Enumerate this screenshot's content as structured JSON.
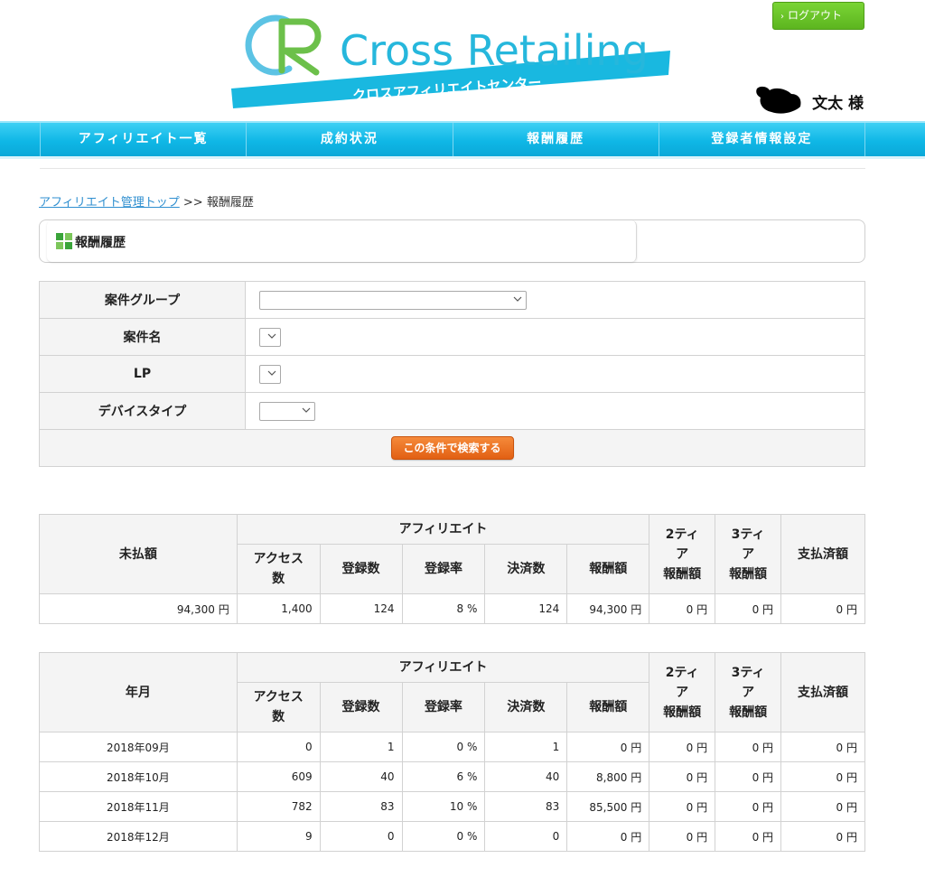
{
  "header": {
    "logo_text": "Cross Retailing",
    "logo_subtext": "クロスアフィリエイトセンター",
    "logout_label": "ログアウト",
    "user_name": "文太 様",
    "colors": {
      "brand_cyan": "#19b8e0",
      "logo_green": "#6cc04a",
      "logout_green": "#6cc52a",
      "search_orange": "#eb7325"
    }
  },
  "nav": {
    "items": [
      "アフィリエイト一覧",
      "成約状況",
      "報酬履歴",
      "登録者情報設定"
    ]
  },
  "breadcrumb": {
    "link": "アフィリエイト管理トップ",
    "separator": ">>",
    "current": "報酬履歴"
  },
  "section": {
    "title": "報酬履歴",
    "icon": "grid-icon"
  },
  "search_form": {
    "rows": [
      {
        "label": "案件グループ",
        "value": ""
      },
      {
        "label": "案件名",
        "value": ""
      },
      {
        "label": "LP",
        "value": ""
      },
      {
        "label": "デバイスタイプ",
        "value": ""
      }
    ],
    "search_button": "この条件で検索する"
  },
  "summary_table": {
    "first_header": "未払額",
    "group_header": "アフィリエイト",
    "sub_headers": [
      "アクセス数",
      "登録数",
      "登録率",
      "決済数",
      "報酬額"
    ],
    "tier2_header": "2ティア報酬額",
    "tier3_header": "3ティア報酬額",
    "paid_header": "支払済額",
    "row": [
      "94,300 円",
      "1,400",
      "124",
      "8 %",
      "124",
      "94,300 円",
      "0 円",
      "0 円",
      "0 円"
    ]
  },
  "monthly_table": {
    "first_header": "年月",
    "group_header": "アフィリエイト",
    "sub_headers": [
      "アクセス数",
      "登録数",
      "登録率",
      "決済数",
      "報酬額"
    ],
    "tier2_header": "2ティア報酬額",
    "tier3_header": "3ティア報酬額",
    "paid_header": "支払済額",
    "rows": [
      [
        "2018年09月",
        "0",
        "1",
        "0 %",
        "1",
        "0 円",
        "0 円",
        "0 円",
        "0 円"
      ],
      [
        "2018年10月",
        "609",
        "40",
        "6 %",
        "40",
        "8,800 円",
        "0 円",
        "0 円",
        "0 円"
      ],
      [
        "2018年11月",
        "782",
        "83",
        "10 %",
        "83",
        "85,500 円",
        "0 円",
        "0 円",
        "0 円"
      ],
      [
        "2018年12月",
        "9",
        "0",
        "0 %",
        "0",
        "0 円",
        "0 円",
        "0 円",
        "0 円"
      ]
    ]
  }
}
